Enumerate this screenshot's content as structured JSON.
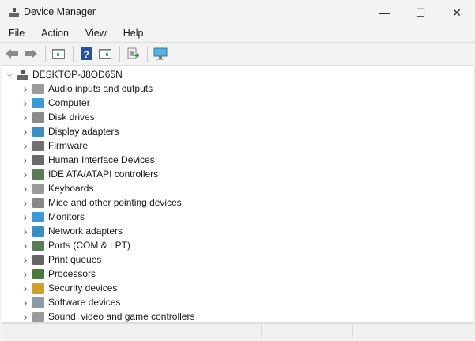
{
  "window": {
    "title": "Device Manager",
    "minimize_icon": "minimize-icon",
    "maximize_icon": "maximize-icon",
    "close_icon": "close-icon",
    "minimize": "—",
    "maximize": "☐",
    "close": "✕"
  },
  "menu": [
    "File",
    "Action",
    "View",
    "Help"
  ],
  "toolbar": [
    "back-icon",
    "forward-icon",
    "properties-icon",
    "help-icon",
    "properties-panel-icon",
    "update-driver-icon",
    "scan-hardware-icon"
  ],
  "tree": {
    "root": "DESKTOP-J8OD65N",
    "items": [
      {
        "label": "Audio inputs and outputs",
        "color": "#9a9a9a"
      },
      {
        "label": "Computer",
        "color": "#3c9ad6"
      },
      {
        "label": "Disk drives",
        "color": "#8a8a8a"
      },
      {
        "label": "Display adapters",
        "color": "#3a8fc2"
      },
      {
        "label": "Firmware",
        "color": "#707070"
      },
      {
        "label": "Human Interface Devices",
        "color": "#6a6a6a"
      },
      {
        "label": "IDE ATA/ATAPI controllers",
        "color": "#5a7a5a"
      },
      {
        "label": "Keyboards",
        "color": "#9a9a9a"
      },
      {
        "label": "Mice and other pointing devices",
        "color": "#888888"
      },
      {
        "label": "Monitors",
        "color": "#3c9ad6"
      },
      {
        "label": "Network adapters",
        "color": "#3a8fc2"
      },
      {
        "label": "Ports (COM & LPT)",
        "color": "#5a7a5a"
      },
      {
        "label": "Print queues",
        "color": "#666666"
      },
      {
        "label": "Processors",
        "color": "#4a7a3a"
      },
      {
        "label": "Security devices",
        "color": "#c9a227"
      },
      {
        "label": "Software devices",
        "color": "#8a9aa8"
      },
      {
        "label": "Sound, video and game controllers",
        "color": "#9a9a9a"
      }
    ]
  }
}
